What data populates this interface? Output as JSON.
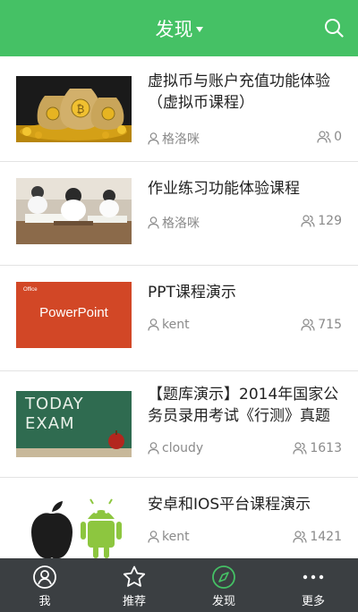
{
  "header": {
    "title": "发现"
  },
  "courses": [
    {
      "title": "虚拟币与账户充值功能体验（虚拟币课程）",
      "author": "格洛咪",
      "count": "0",
      "thumb": "bitcoin-bags"
    },
    {
      "title": "作业练习功能体验课程",
      "author": "格洛咪",
      "count": "129",
      "thumb": "classroom-students"
    },
    {
      "title": "PPT课程演示",
      "author": "kent",
      "count": "715",
      "thumb": "powerpoint-cover",
      "thumb_text": "PowerPoint",
      "thumb_small_text": "Office"
    },
    {
      "title": "【题库演示】2014年国家公务员录用考试《行测》真题",
      "author": "cloudy",
      "count": "1613",
      "thumb": "chalkboard-today-exam",
      "thumb_text_line1": "TODAY",
      "thumb_text_line2": "EXAM"
    },
    {
      "title": "安卓和IOS平台课程演示",
      "author": "kent",
      "count": "1421",
      "thumb": "apple-android"
    }
  ],
  "tabbar": {
    "items": [
      {
        "label": "我",
        "icon": "user-icon"
      },
      {
        "label": "推荐",
        "icon": "star-icon"
      },
      {
        "label": "发现",
        "icon": "compass-icon",
        "active": true
      },
      {
        "label": "更多",
        "icon": "more-icon"
      }
    ]
  },
  "colors": {
    "header": "#45c165",
    "tabbar": "#3b3f42",
    "active": "#45c165",
    "meta": "#8a8a8a"
  }
}
